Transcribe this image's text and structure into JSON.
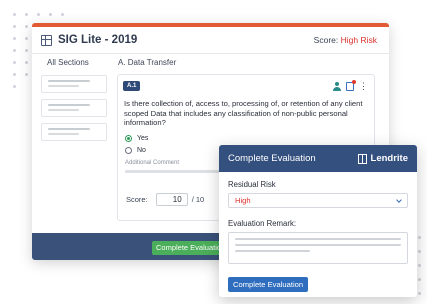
{
  "window": {
    "title": "SIG Lite - 2019",
    "score_label": "Score:",
    "score_value": "High Risk",
    "icon": "document-icon"
  },
  "sidebar": {
    "title": "All Sections"
  },
  "section": {
    "title": "A. Data Transfer"
  },
  "question": {
    "badge": "A.1",
    "text": "Is there collection of, access to, processing of, or retention of any client scoped Data that includes any classification of non-public personal information?",
    "options": [
      "Yes",
      "No"
    ],
    "selected_option": "Yes",
    "comment_label": "Additional Comment",
    "score_label": "Score:",
    "score_value": "10",
    "score_max": "/ 10"
  },
  "footer": {
    "complete_label": "Complete Evaluation"
  },
  "panel": {
    "title": "Complete Evaluation",
    "brand": "Lendrite",
    "residual_label": "Residual Risk",
    "residual_value": "High",
    "remark_label": "Evaluation Remark:",
    "button_label": "Complete Evaluation"
  },
  "colors": {
    "accent_top": "#e15a34",
    "risk_red": "#d9302c",
    "navy": "#34507f",
    "green_button": "#4bae5a",
    "blue_button": "#2f6ebf"
  }
}
